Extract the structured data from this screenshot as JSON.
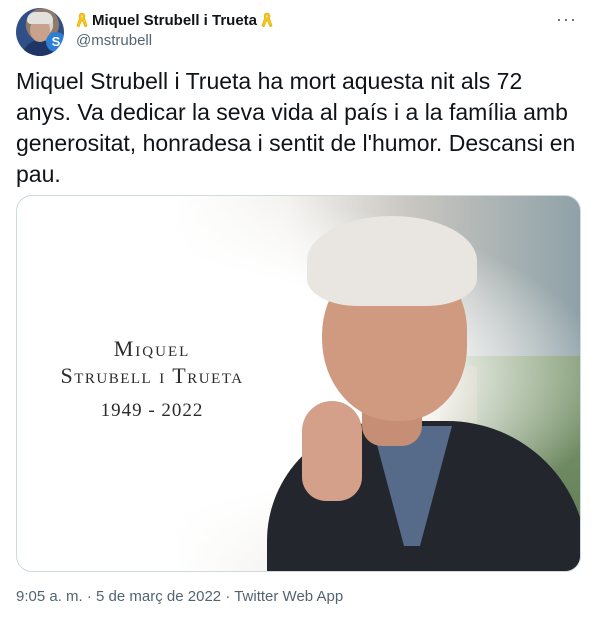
{
  "author": {
    "display_name": "Miquel Strubell i Trueta",
    "handle": "@mstrubell",
    "ribbon_icon": "yellow-ribbon-icon",
    "ribbon_color": "#f5c518"
  },
  "tweet": {
    "text": "Miquel Strubell i Trueta ha mort aquesta nit als 72 anys. Va dedicar la seva vida al país i a la família amb generositat, honradesa i sentit de l'humor. Descansi en pau.",
    "more_icon": "more-options-icon"
  },
  "media": {
    "caption_first": "Miquel",
    "caption_last": "Strubell i Trueta",
    "caption_years": "1949 - 2022"
  },
  "meta": {
    "time": "9:05 a. m.",
    "separator": "·",
    "date": "5 de març de 2022",
    "source": "Twitter Web App"
  },
  "colors": {
    "text": "#0f1419",
    "secondary": "#536471",
    "border": "#cfd9de"
  }
}
